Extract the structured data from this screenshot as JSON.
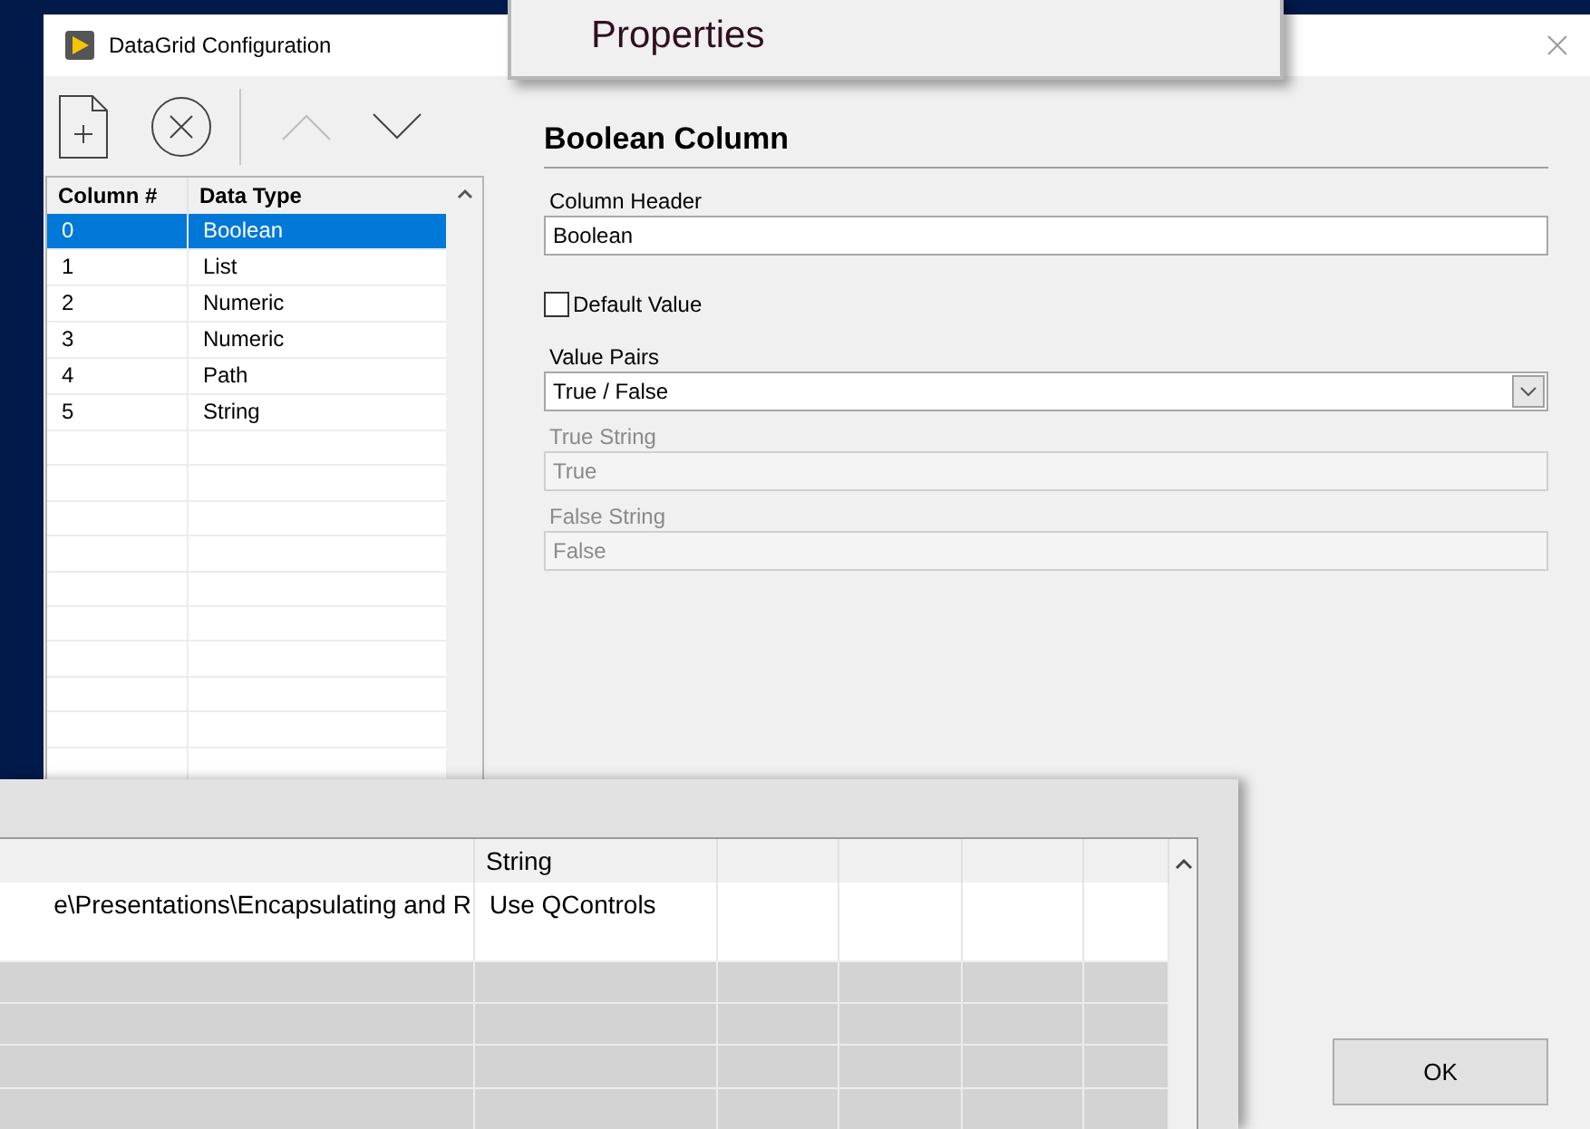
{
  "dialog": {
    "title": "DataGrid Configuration",
    "toolbar": [
      {
        "kind": "add",
        "disabled": false
      },
      {
        "kind": "remove",
        "disabled": false
      },
      {
        "kind": "up",
        "disabled": true
      },
      {
        "kind": "down",
        "disabled": false
      }
    ],
    "table": {
      "columns": [
        "Column #",
        "Data Type"
      ],
      "rows": [
        {
          "cells": [
            "0",
            "Boolean"
          ],
          "selected": true
        },
        {
          "cells": [
            "1",
            "List"
          ],
          "selected": false
        },
        {
          "cells": [
            "2",
            "Numeric"
          ],
          "selected": false
        },
        {
          "cells": [
            "3",
            "Numeric"
          ],
          "selected": false
        },
        {
          "cells": [
            "4",
            "Path"
          ],
          "selected": false
        },
        {
          "cells": [
            "5",
            "String"
          ],
          "selected": false
        }
      ]
    },
    "section_title": "Boolean Column",
    "fields": [
      {
        "kind": "text",
        "label": "Column Header",
        "value": "Boolean",
        "disabled": false
      },
      {
        "kind": "checkbox",
        "label": "Default Value",
        "checked": false
      },
      {
        "kind": "select",
        "label": "Value Pairs",
        "value": "True / False",
        "disabled": false
      },
      {
        "kind": "text",
        "label": "True String",
        "value": "True",
        "disabled": true
      },
      {
        "kind": "text",
        "label": "False String",
        "value": "False",
        "disabled": true
      }
    ],
    "ok_button": "OK"
  },
  "popup": {
    "label": "Properties"
  },
  "grid_window": {
    "columns": [
      "",
      "String",
      "",
      "",
      "",
      ""
    ],
    "rows": [
      [
        "e\\Presentations\\Encapsulating and R",
        "Use QControls"
      ]
    ]
  }
}
